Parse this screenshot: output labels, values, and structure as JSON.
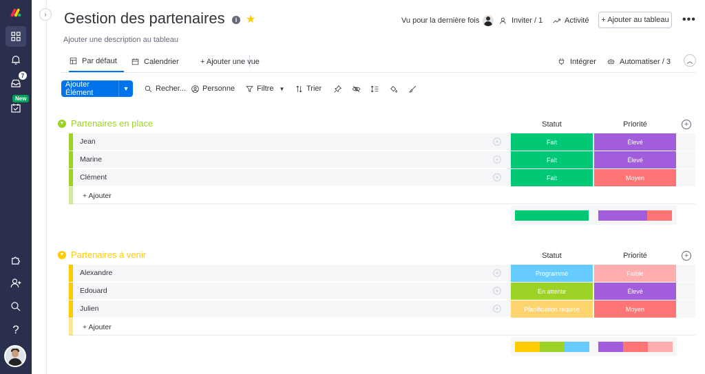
{
  "header": {
    "title": "Gestion des partenaires",
    "description": "Ajouter une description au tableau",
    "last_seen": "Vu pour la dernière fois",
    "invite": "Inviter / 1",
    "activity": "Activité",
    "add_to_board": "+ Ajouter au tableau",
    "more": "•••"
  },
  "sidebar": {
    "inbox_badge": "7",
    "new_badge": "New"
  },
  "tabs": [
    {
      "label": "Par défaut",
      "icon": "table-icon",
      "active": true
    },
    {
      "label": "Calendrier",
      "icon": "calendar-icon"
    },
    {
      "label": "+ Ajouter une vue"
    }
  ],
  "tabs_right": {
    "integrate": "Intégrer",
    "automate": "Automatiser / 3"
  },
  "toolbar": {
    "add_item": "Ajouter Élément",
    "search": "Recher...",
    "person": "Personne",
    "filter": "Filtre",
    "sort": "Trier"
  },
  "columns": {
    "status": "Statut",
    "priority": "Priorité"
  },
  "add_row_label": "+ Ajouter",
  "colors": {
    "done": "#00c875",
    "high": "#a25ddc",
    "medium": "#ff7575",
    "scheduled": "#66ccff",
    "waiting": "#9cd326",
    "planning": "#fdd46d",
    "low": "#ffadad",
    "group1": "#9cd326",
    "group2": "#ffcb00"
  },
  "groups": [
    {
      "title": "Partenaires en place",
      "color": "#9cd326",
      "rows": [
        {
          "name": "Jean",
          "status": "Fait",
          "status_color": "#00c875",
          "priority": "Élevé",
          "priority_color": "#a25ddc"
        },
        {
          "name": "Marine",
          "status": "Fait",
          "status_color": "#00c875",
          "priority": "Élevé",
          "priority_color": "#a25ddc"
        },
        {
          "name": "Clément",
          "status": "Fait",
          "status_color": "#00c875",
          "priority": "Moyen",
          "priority_color": "#ff7575"
        }
      ],
      "status_summary": [
        {
          "color": "#00c875",
          "fraction": 1.0
        }
      ],
      "priority_summary": [
        {
          "color": "#a25ddc",
          "fraction": 0.667
        },
        {
          "color": "#ff7575",
          "fraction": 0.333
        }
      ]
    },
    {
      "title": "Partenaires à venir",
      "color": "#ffcb00",
      "rows": [
        {
          "name": "Alexandre",
          "status": "Programmé",
          "status_color": "#66ccff",
          "priority": "Faible",
          "priority_color": "#ffadad"
        },
        {
          "name": "Edouard",
          "status": "En attente",
          "status_color": "#9cd326",
          "priority": "Élevé",
          "priority_color": "#a25ddc"
        },
        {
          "name": "Julien",
          "status": "Planification requise",
          "status_color": "#fdd46d",
          "priority": "Moyen",
          "priority_color": "#ff7575"
        }
      ],
      "status_summary": [
        {
          "color": "#ffcb00",
          "fraction": 0.333
        },
        {
          "color": "#9cd326",
          "fraction": 0.333
        },
        {
          "color": "#66ccff",
          "fraction": 0.334
        }
      ],
      "priority_summary": [
        {
          "color": "#a25ddc",
          "fraction": 0.333
        },
        {
          "color": "#ff7575",
          "fraction": 0.333
        },
        {
          "color": "#ffadad",
          "fraction": 0.334
        }
      ]
    }
  ]
}
